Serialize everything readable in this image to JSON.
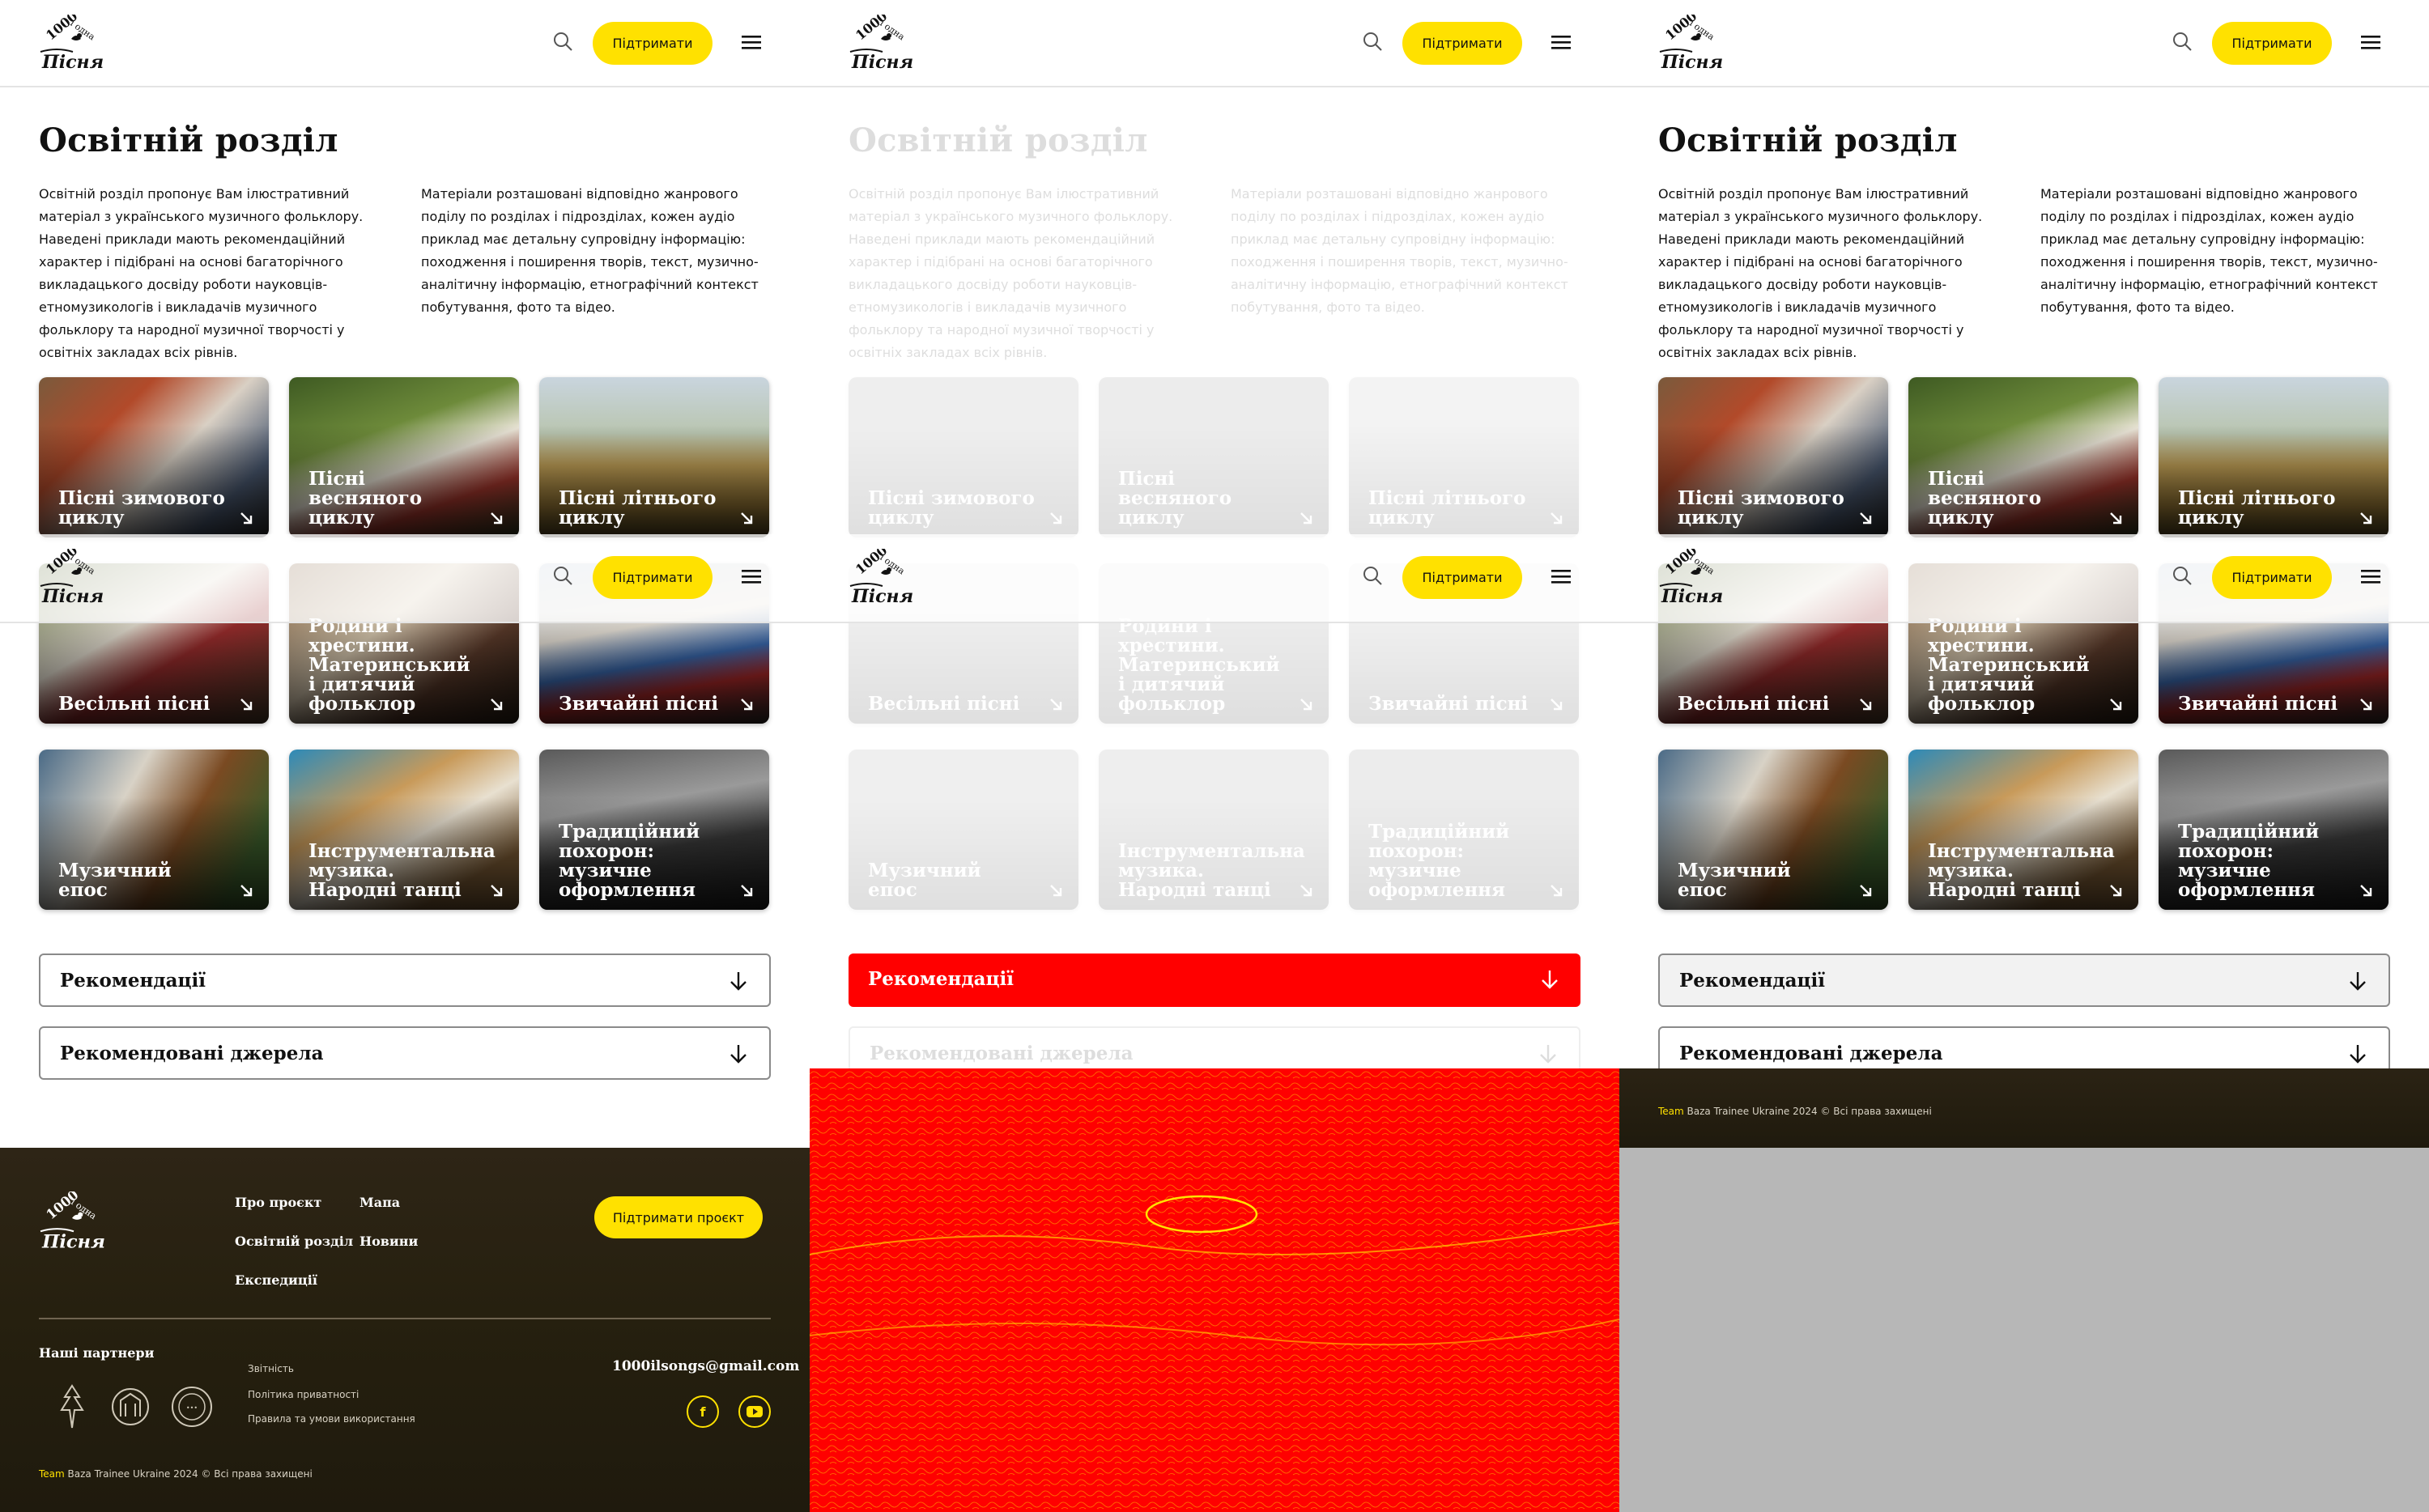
{
  "header": {
    "support_label": "Підтримати"
  },
  "page": {
    "title": "Освітній розділ",
    "intro_col1": "Освітній розділ пропонує Вам ілюстративний матеріал з українського музичного фольклору. Наведені приклади мають рекомендаційний характер і підібрані на основі багаторічного викладацького досвіду роботи науковців-етномузикологів і викладачів музичного фольклору та народної музичної творчості у освітніх закладах всіх рівнів.",
    "intro_col2": "Матеріали розташовані відповідно жанрового поділу по розділах і підрозділах, кожен аудіо приклад має детальну супровідну інформацію: походження і поширення творів, текст, музично-аналітичну інформацію, етнографічний контекст побутування, фото та відео."
  },
  "cards": [
    {
      "label": "Пісні зимового циклу"
    },
    {
      "label": "Пісні весняного циклу"
    },
    {
      "label": "Пісні літнього циклу"
    },
    {
      "label": "Весільні пісні"
    },
    {
      "label": "Родини і хрестини. Материнський і дитячий фольклор"
    },
    {
      "label": "Звичайні пісні"
    },
    {
      "label": "Музичний епос"
    },
    {
      "label": "Інструментальна музика. Народні танці"
    },
    {
      "label": "Традиційний похорон: музичне оформлення"
    }
  ],
  "accordions": {
    "recommendations": "Рекомендації",
    "sources": "Рекомендовані джерела"
  },
  "footer": {
    "links": {
      "about": "Про проєкт",
      "map": "Мапа",
      "education": "Освітній розділ",
      "news": "Новини",
      "expeditions": "Експедиції"
    },
    "support_label": "Підтримати проєкт",
    "partners_title": "Наші партнери",
    "small_links": {
      "reports": "Звітність",
      "privacy": "Політика приватності",
      "terms": "Правила та умови використання"
    },
    "email": "1000ilsongs@gmail.com",
    "copyright_team": "Team",
    "copyright_rest": " Baza Trainee Ukraine 2024 © Всі права захищені"
  },
  "icons": {
    "search": "search-icon",
    "menu": "hamburger-menu-icon",
    "card_arrow": "arrow-down-right-icon",
    "accordion": "arrow-down-icon",
    "facebook": "facebook-icon",
    "youtube": "youtube-icon"
  },
  "colors": {
    "accent_yellow": "#ffe100",
    "footer_bg": "#2b2314",
    "highlight_red": "#ff0000",
    "text": "#111111"
  }
}
